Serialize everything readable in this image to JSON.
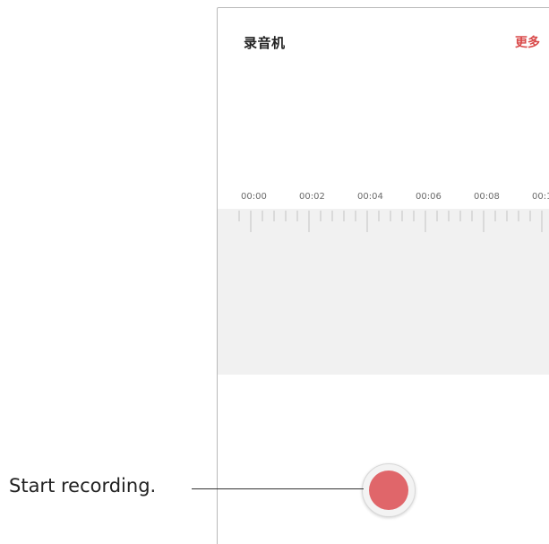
{
  "app": {
    "title": "录音机",
    "more_label": "更多"
  },
  "timeline": {
    "labels": [
      "00:00",
      "00:02",
      "00:04",
      "00:06",
      "00:08",
      "00:1"
    ]
  },
  "record_button": {
    "state": "idle",
    "color": "#e0666a"
  },
  "callout": {
    "text": "Start recording."
  },
  "colors": {
    "accent": "#d94a4a",
    "panel": "#f1f1f1"
  }
}
